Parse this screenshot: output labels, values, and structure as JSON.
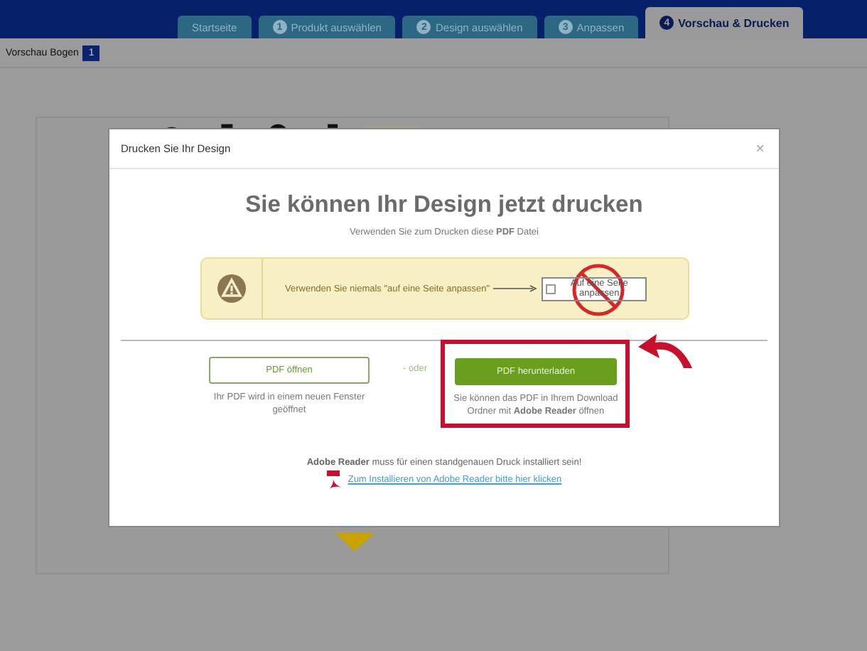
{
  "header": {
    "tabs": [
      {
        "label": "Startseite",
        "selected": false
      },
      {
        "step": "1",
        "label": "Produkt auswählen",
        "selected": false
      },
      {
        "step": "2",
        "label": "Design auswählen",
        "selected": false
      },
      {
        "step": "3",
        "label": "Anpassen",
        "selected": false
      },
      {
        "step": "4",
        "label": "Vorschau & Drucken",
        "selected": true
      }
    ]
  },
  "toolbar": {
    "label": "Vorschau Bogen",
    "page": "1"
  },
  "dialog": {
    "title": "Drucken Sie Ihr Design",
    "close": "×",
    "heading": "Sie können Ihr Design jetzt drucken",
    "subheading": "Verwenden Sie zum Drucken diese **PDF** Datei",
    "warning": {
      "text": "Verwenden Sie niemals \"auf eine Seite anpassen\"",
      "checkbox_label": "Auf eine Seite anpassen",
      "checked": false
    },
    "open_button": "PDF öffnen",
    "open_hint": "Ihr PDF wird in einem neuen Fenster geöffnet",
    "separator": "- oder",
    "download_button": "PDF herunterladen",
    "download_hint": "Sie können das PDF in Ihrem Download Ordner mit **Adobe Reader** öffnen",
    "adobe_note": "**Adobe Reader** muss für einen standgenauen Druck installiert sein!",
    "install_link": "Zum Installieren von Adobe Reader bitte hier klicken"
  }
}
